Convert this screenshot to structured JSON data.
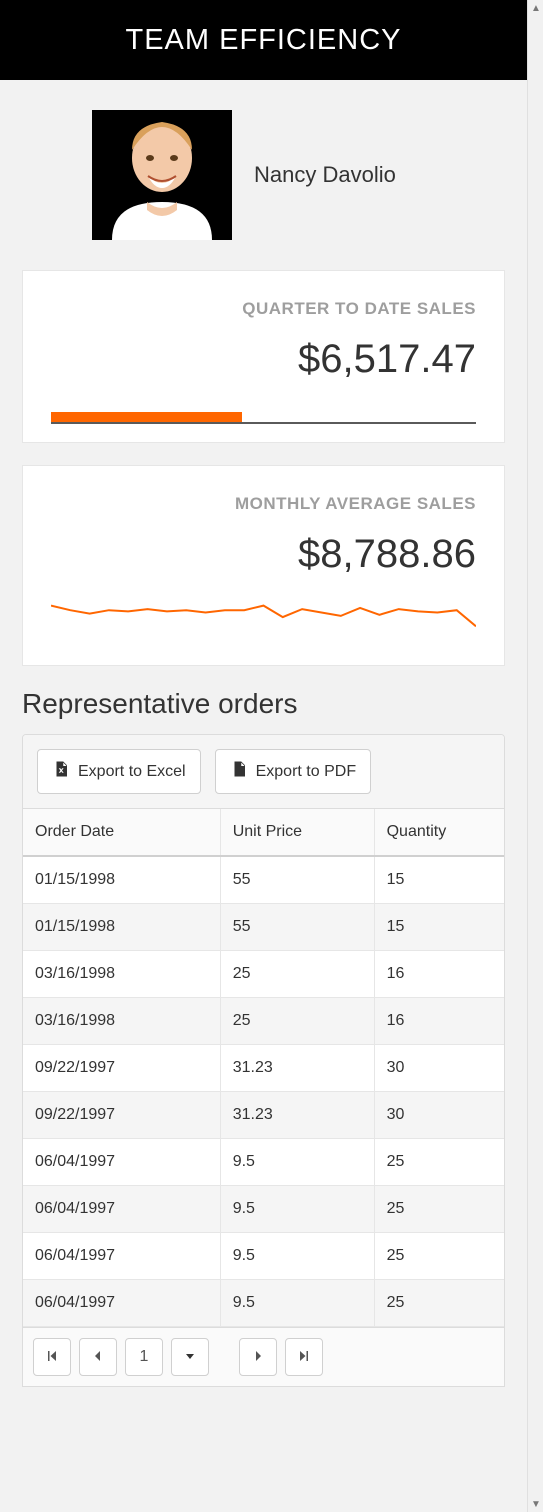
{
  "header": {
    "title": "TEAM EFFICIENCY"
  },
  "profile": {
    "name": "Nancy Davolio"
  },
  "cards": {
    "qtd": {
      "label": "QUARTER TO DATE SALES",
      "value": "$6,517.47"
    },
    "monthly": {
      "label": "MONTHLY AVERAGE SALES",
      "value": "$8,788.86"
    }
  },
  "chart_data": [
    {
      "type": "bar",
      "title": "Quarter to date sales progress",
      "series": [
        {
          "name": "progress",
          "values": [
            0.45
          ]
        }
      ],
      "xlim": [
        0,
        1
      ],
      "colors": {
        "fill": "#ff6600",
        "track": "#5a5a5a"
      }
    },
    {
      "type": "line",
      "title": "Monthly sales sparkline",
      "x": [
        0,
        1,
        2,
        3,
        4,
        5,
        6,
        7,
        8,
        9,
        10,
        11,
        12,
        13,
        14,
        15,
        16,
        17,
        18,
        19,
        20,
        21,
        22
      ],
      "series": [
        {
          "name": "monthly",
          "values": [
            36,
            32,
            29,
            32,
            31,
            33,
            31,
            32,
            30,
            32,
            32,
            36,
            26,
            33,
            30,
            27,
            34,
            28,
            33,
            31,
            30,
            32,
            18
          ]
        }
      ],
      "ylim": [
        0,
        40
      ],
      "colors": {
        "line": "#ff6600"
      }
    }
  ],
  "orders": {
    "title": "Representative orders",
    "toolbar": {
      "excel": "Export to Excel",
      "pdf": "Export to PDF"
    },
    "columns": {
      "date": "Order Date",
      "price": "Unit Price",
      "qty": "Quantity"
    },
    "rows": [
      {
        "date": "01/15/1998",
        "price": "55",
        "qty": "15"
      },
      {
        "date": "01/15/1998",
        "price": "55",
        "qty": "15"
      },
      {
        "date": "03/16/1998",
        "price": "25",
        "qty": "16"
      },
      {
        "date": "03/16/1998",
        "price": "25",
        "qty": "16"
      },
      {
        "date": "09/22/1997",
        "price": "31.23",
        "qty": "30"
      },
      {
        "date": "09/22/1997",
        "price": "31.23",
        "qty": "30"
      },
      {
        "date": "06/04/1997",
        "price": "9.5",
        "qty": "25"
      },
      {
        "date": "06/04/1997",
        "price": "9.5",
        "qty": "25"
      },
      {
        "date": "06/04/1997",
        "price": "9.5",
        "qty": "25"
      },
      {
        "date": "06/04/1997",
        "price": "9.5",
        "qty": "25"
      }
    ],
    "pager": {
      "page": "1"
    }
  }
}
